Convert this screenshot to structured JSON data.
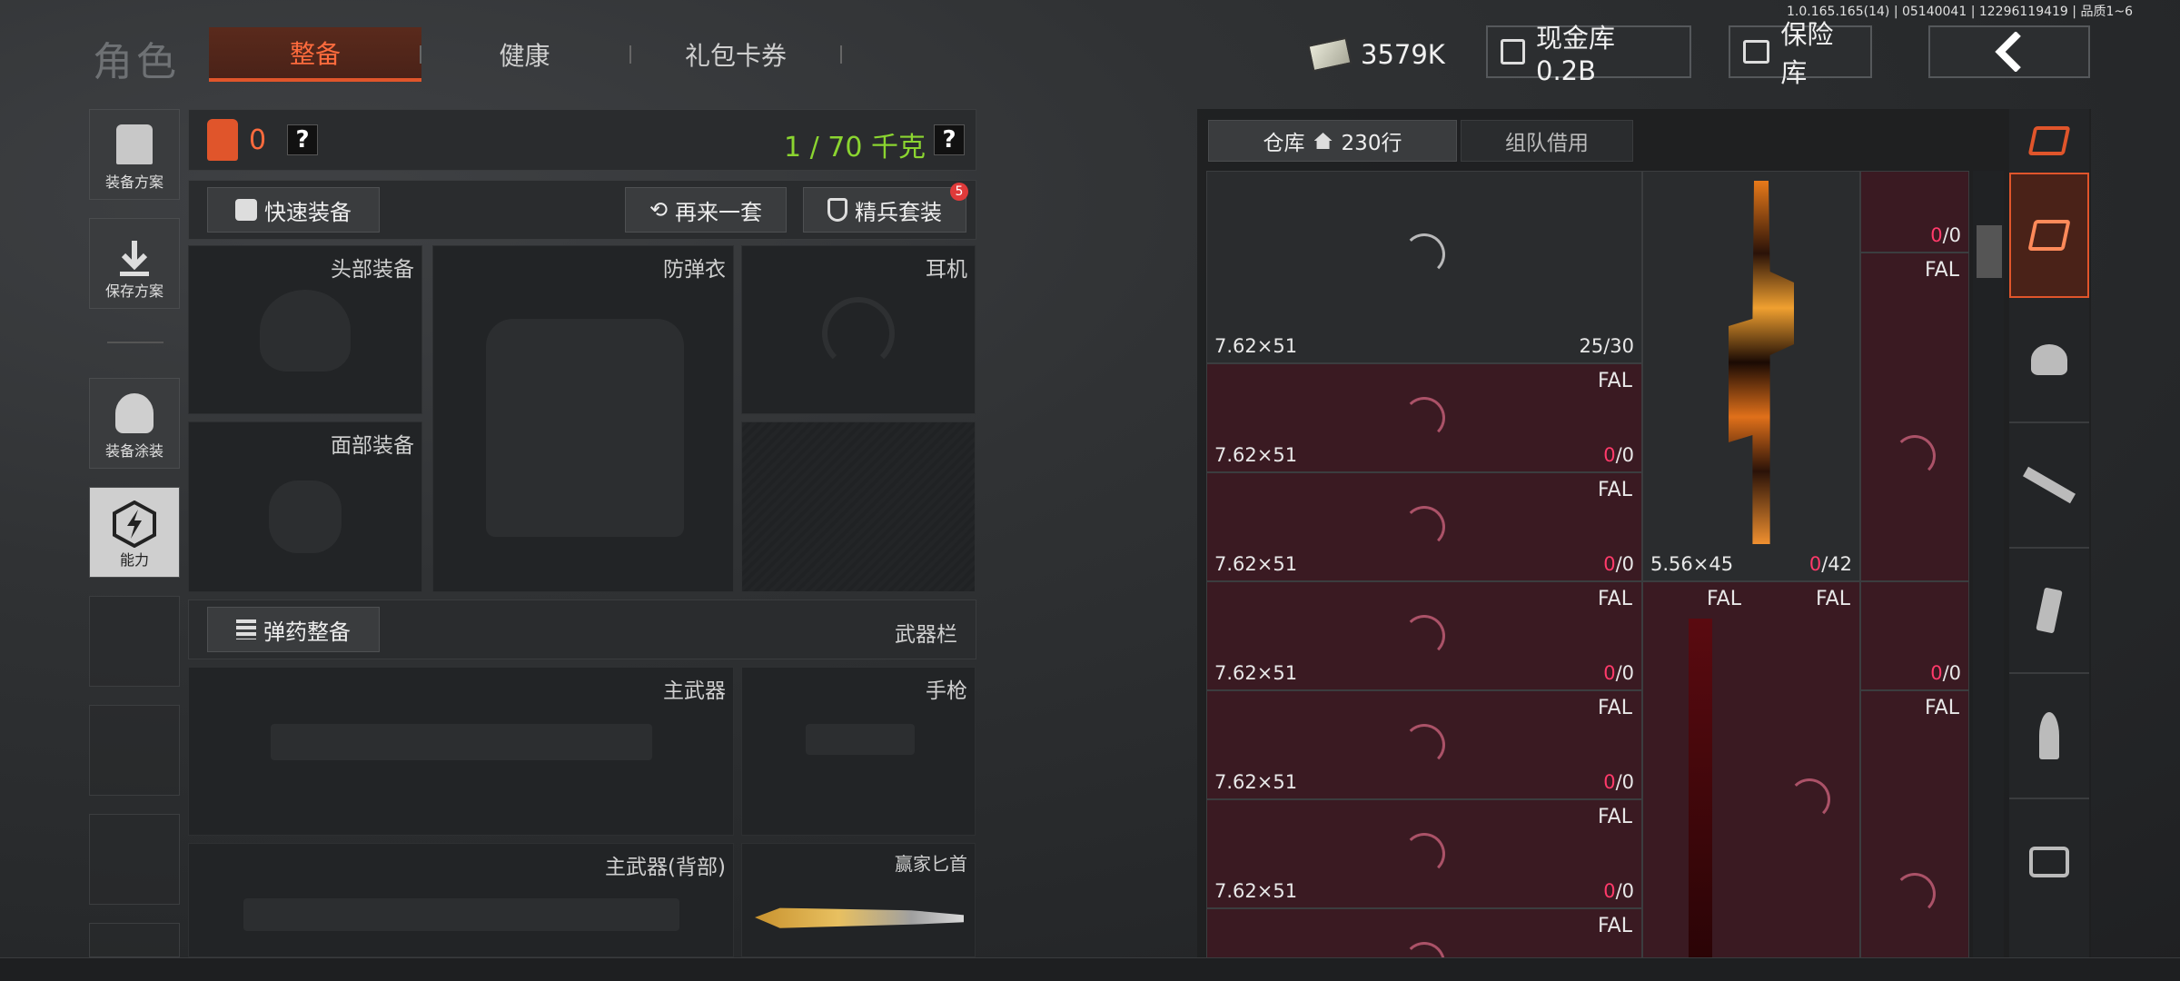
{
  "version": "1.0.165.165(14) | 05140041 | 12296119419 | 品质1~6",
  "header": {
    "role_title": "角色",
    "tabs": [
      "整备",
      "健康",
      "礼包卡券"
    ],
    "money": "3579K",
    "cash_vault": "现金库 0.2B",
    "safe": "保险库"
  },
  "left_sidebar": {
    "items": [
      "装备方案",
      "保存方案",
      "装备涂装",
      "能力"
    ]
  },
  "equip": {
    "vest_count": "0",
    "weight": "1 / 70 千克",
    "quick_equip": "快速装备",
    "again": "再来一套",
    "elite_set": "精兵套装",
    "elite_badge": "5",
    "slots": {
      "head": "头部装备",
      "armor": "防弹衣",
      "earphone": "耳机",
      "face": "面部装备",
      "ammo": "弹药整备",
      "weapon_bar": "武器栏",
      "primary": "主武器",
      "pistol": "手枪",
      "primary_back": "主武器(背部)",
      "knife": "赢家匕首"
    }
  },
  "warehouse": {
    "tab_storage": "仓库",
    "rows": "230行",
    "tab_team": "组队借用",
    "cells": [
      {
        "cal": "7.62×51",
        "count_pre": "25/30",
        "count_zero": "",
        "name": ""
      },
      {
        "cal": "7.62×51",
        "count_pre": "/0",
        "count_zero": "0",
        "name": "FAL"
      },
      {
        "cal": "7.62×51",
        "count_pre": "/0",
        "count_zero": "0",
        "name": "FAL"
      },
      {
        "cal": "7.62×51",
        "count_pre": "/0",
        "count_zero": "0",
        "name": "FAL"
      },
      {
        "cal": "7.62×51",
        "count_pre": "/0",
        "count_zero": "0",
        "name": "FAL"
      },
      {
        "cal": "7.62×51",
        "count_pre": "/0",
        "count_zero": "0",
        "name": "FAL"
      }
    ],
    "last_name": "FAL",
    "rifle_cal": "5.56×45",
    "rifle_count_zero": "0",
    "rifle_count_pre": "/42",
    "right_col_top_zero": "0",
    "right_col_top_pre": "/0",
    "right_col_name": "FAL",
    "mid_name_a": "FAL",
    "mid_name_b": "FAL",
    "right_col_mid_zero": "0",
    "right_col_mid_pre": "/0",
    "right_col_low_name": "FAL"
  },
  "colors": {
    "accent": "#e0552b",
    "zero": "#ff3a6a",
    "weight": "#8bd530"
  }
}
